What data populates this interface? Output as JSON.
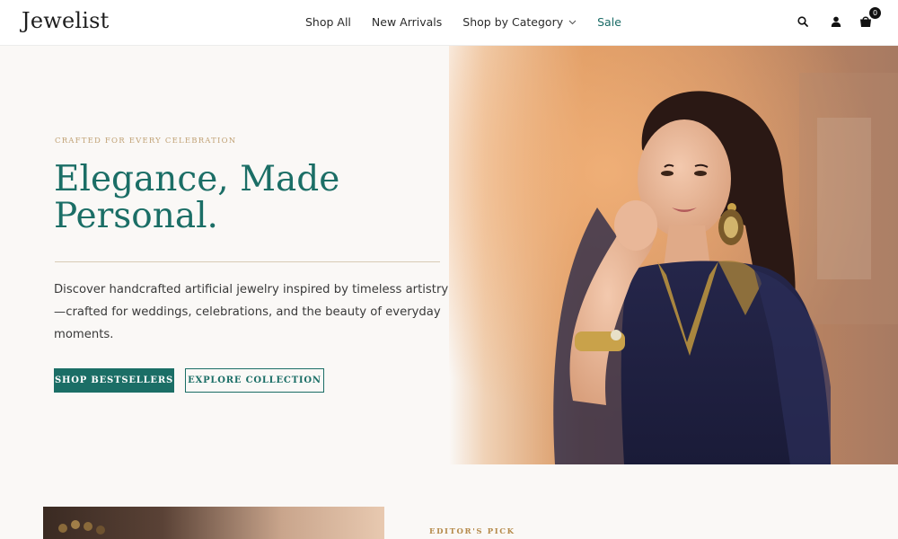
{
  "header": {
    "logo": "Jewelist",
    "nav": [
      {
        "label": "Shop All"
      },
      {
        "label": "New Arrivals"
      },
      {
        "label": "Shop by Category"
      },
      {
        "label": "Sale"
      }
    ],
    "cart_count": "0",
    "icons": [
      "search-icon",
      "user-icon",
      "cart-icon",
      "chevron-down-icon"
    ]
  },
  "hero": {
    "eyebrow": "CRAFTED FOR EVERY CELEBRATION",
    "headline": "Elegance, Made Personal.",
    "description": "Discover handcrafted artificial jewelry inspired by timeless artistry—crafted for weddings, celebrations, and the beauty of everyday moments.",
    "primary_button": "SHOP BESTSELLERS",
    "secondary_button": "EXPLORE COLLECTION"
  },
  "featured": {
    "eyebrow": "EDITOR'S PICK"
  },
  "colors": {
    "accent": "#1b6e66",
    "gold": "#c0a174",
    "background": "#faf8f6"
  }
}
